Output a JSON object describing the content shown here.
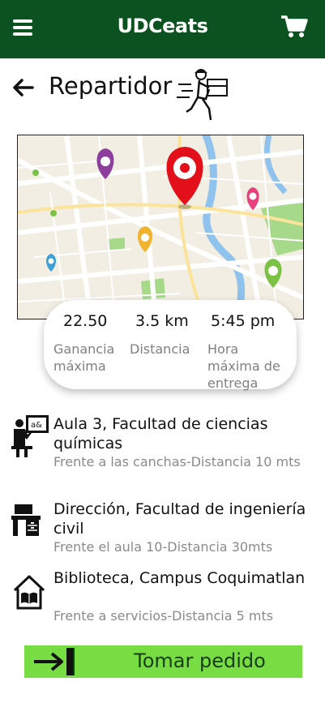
{
  "header": {
    "app_title": "UDCeats",
    "menu_icon": "hamburger-menu-icon",
    "cart_icon": "shopping-cart-icon",
    "background_color": "#0b5220"
  },
  "page": {
    "title": "Repartidor",
    "back_icon": "back-arrow-icon",
    "courier_icon": "delivery-courier-icon"
  },
  "map": {
    "pins": [
      {
        "color": "#8e3e9c"
      },
      {
        "color": "#e30f1a"
      },
      {
        "color": "#e8407a"
      },
      {
        "color": "#f1b22e"
      },
      {
        "color": "#3d9fd8"
      },
      {
        "color": "#7bc144"
      }
    ]
  },
  "stats": {
    "earnings_value": "22.50",
    "earnings_label": "Ganancia máxima",
    "distance_value": "3.5 km",
    "distance_label": "Distancia",
    "time_value": "5:45 pm",
    "time_label": "Hora máxima de entrega"
  },
  "locations": [
    {
      "icon": "classroom-teacher-icon",
      "title": "Aula 3, Facultad de ciencias químicas",
      "subtitle": "Frente a las canchas-Distancia 10 mts"
    },
    {
      "icon": "office-desk-icon",
      "title": "Dirección, Facultad de ingeniería civil",
      "subtitle": "Frente el aula 10-Distancia 30mts"
    },
    {
      "icon": "library-icon",
      "title": "Biblioteca, Campus Coquimatlan",
      "subtitle": "Frente a servicios-Distancia 5 mts"
    }
  ],
  "action": {
    "take_order_label": "Tomar pedido",
    "icon": "enter-arrow-icon",
    "color": "#77dd43"
  }
}
